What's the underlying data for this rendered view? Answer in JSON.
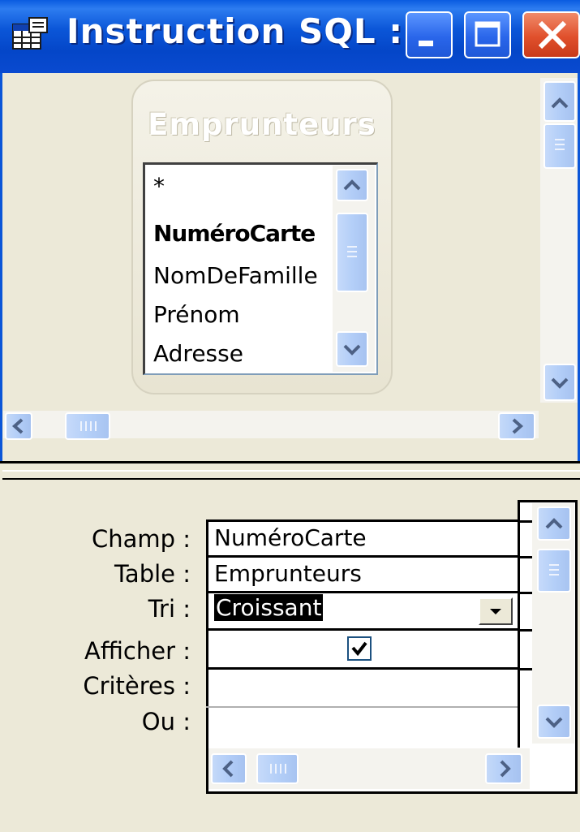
{
  "window": {
    "title": "Instruction SQL :...",
    "buttons": {
      "minimize": "minimize",
      "maximize": "maximize",
      "close": "close"
    }
  },
  "table_box": {
    "title": "Emprunteurs",
    "fields": [
      {
        "label": "*",
        "bold": false
      },
      {
        "label": "NuméroCarte",
        "bold": true
      },
      {
        "label": "NomDeFamille",
        "bold": false
      },
      {
        "label": "Prénom",
        "bold": false
      },
      {
        "label": "Adresse",
        "bold": false
      }
    ]
  },
  "grid": {
    "row_labels": {
      "champ": "Champ :",
      "table": "Table :",
      "tri": "Tri :",
      "afficher": "Afficher :",
      "criteres": "Critères :",
      "ou": "Ou :"
    },
    "column": {
      "champ": "NuméroCarte",
      "table": "Emprunteurs",
      "tri": "Croissant",
      "afficher": true,
      "criteres": "",
      "ou": ""
    }
  },
  "icons": {
    "window_icon": "query-grid-icon",
    "scroll_up": "chevron-up-icon",
    "scroll_down": "chevron-down-icon",
    "scroll_left": "chevron-left-icon",
    "scroll_right": "chevron-right-icon",
    "dropdown": "triangle-down-icon",
    "checkbox": "checkmark-icon"
  },
  "colors": {
    "titlebar": "#0b56d8",
    "window_bg": "#ece9d8",
    "close_button": "#e0502c",
    "scrollbar": "#b4cff8"
  }
}
